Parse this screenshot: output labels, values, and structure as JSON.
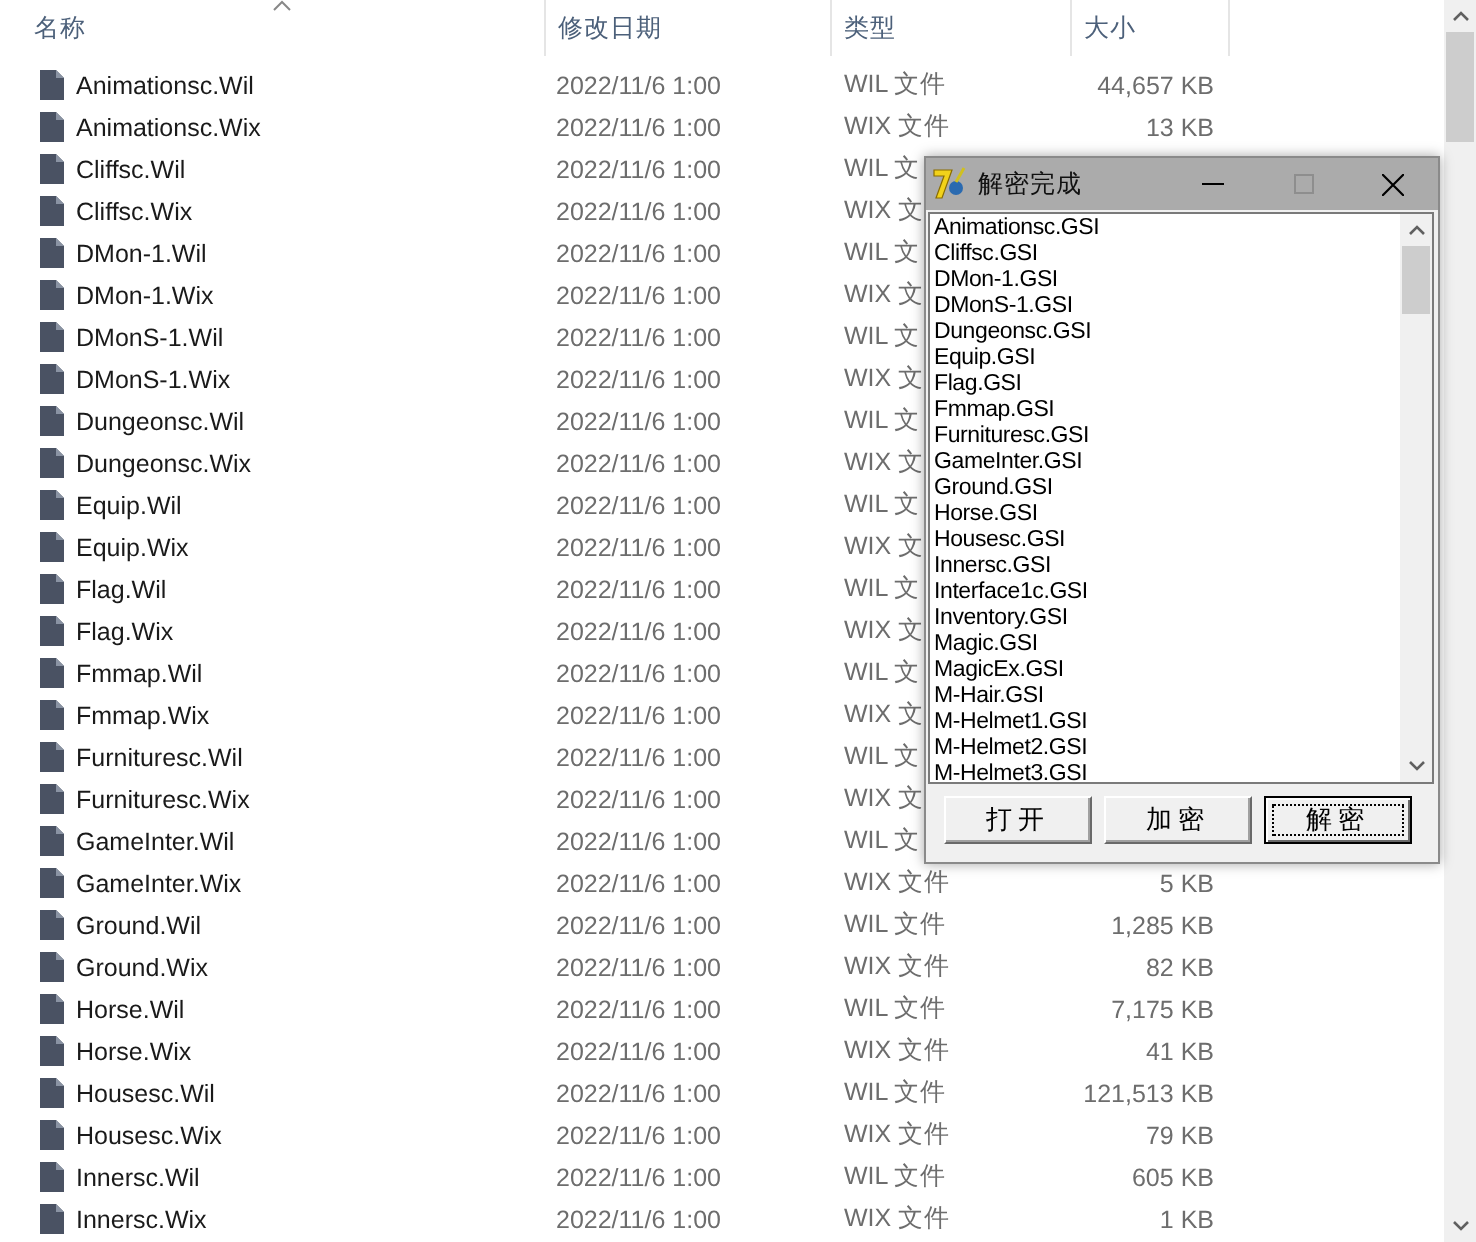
{
  "columns": [
    {
      "label": "名称",
      "sorted": true
    },
    {
      "label": "修改日期",
      "sorted": false
    },
    {
      "label": "类型",
      "sorted": false
    },
    {
      "label": "大小",
      "sorted": false
    }
  ],
  "files": [
    {
      "name": "Animationsc.Wil",
      "date": "2022/11/6 1:00",
      "type": "WIL 文件",
      "size": "44,657 KB"
    },
    {
      "name": "Animationsc.Wix",
      "date": "2022/11/6 1:00",
      "type": "WIX 文件",
      "size": "13 KB"
    },
    {
      "name": "Cliffsc.Wil",
      "date": "2022/11/6 1:00",
      "type": "WIL 文"
    },
    {
      "name": "Cliffsc.Wix",
      "date": "2022/11/6 1:00",
      "type": "WIX 文"
    },
    {
      "name": "DMon-1.Wil",
      "date": "2022/11/6 1:00",
      "type": "WIL 文"
    },
    {
      "name": "DMon-1.Wix",
      "date": "2022/11/6 1:00",
      "type": "WIX 文"
    },
    {
      "name": "DMonS-1.Wil",
      "date": "2022/11/6 1:00",
      "type": "WIL 文"
    },
    {
      "name": "DMonS-1.Wix",
      "date": "2022/11/6 1:00",
      "type": "WIX 文"
    },
    {
      "name": "Dungeonsc.Wil",
      "date": "2022/11/6 1:00",
      "type": "WIL 文"
    },
    {
      "name": "Dungeonsc.Wix",
      "date": "2022/11/6 1:00",
      "type": "WIX 文"
    },
    {
      "name": "Equip.Wil",
      "date": "2022/11/6 1:00",
      "type": "WIL 文"
    },
    {
      "name": "Equip.Wix",
      "date": "2022/11/6 1:00",
      "type": "WIX 文"
    },
    {
      "name": "Flag.Wil",
      "date": "2022/11/6 1:00",
      "type": "WIL 文"
    },
    {
      "name": "Flag.Wix",
      "date": "2022/11/6 1:00",
      "type": "WIX 文"
    },
    {
      "name": "Fmmap.Wil",
      "date": "2022/11/6 1:00",
      "type": "WIL 文"
    },
    {
      "name": "Fmmap.Wix",
      "date": "2022/11/6 1:00",
      "type": "WIX 文"
    },
    {
      "name": "Furnituresc.Wil",
      "date": "2022/11/6 1:00",
      "type": "WIL 文"
    },
    {
      "name": "Furnituresc.Wix",
      "date": "2022/11/6 1:00",
      "type": "WIX 文"
    },
    {
      "name": "GameInter.Wil",
      "date": "2022/11/6 1:00",
      "type": "WIL 文"
    },
    {
      "name": "GameInter.Wix",
      "date": "2022/11/6 1:00",
      "type": "WIX 文件",
      "size": "5 KB"
    },
    {
      "name": "Ground.Wil",
      "date": "2022/11/6 1:00",
      "type": "WIL 文件",
      "size": "1,285 KB"
    },
    {
      "name": "Ground.Wix",
      "date": "2022/11/6 1:00",
      "type": "WIX 文件",
      "size": "82 KB"
    },
    {
      "name": "Horse.Wil",
      "date": "2022/11/6 1:00",
      "type": "WIL 文件",
      "size": "7,175 KB"
    },
    {
      "name": "Horse.Wix",
      "date": "2022/11/6 1:00",
      "type": "WIX 文件",
      "size": "41 KB"
    },
    {
      "name": "Housesc.Wil",
      "date": "2022/11/6 1:00",
      "type": "WIL 文件",
      "size": "121,513 KB"
    },
    {
      "name": "Housesc.Wix",
      "date": "2022/11/6 1:00",
      "type": "WIX 文件",
      "size": "79 KB"
    },
    {
      "name": "Innersc.Wil",
      "date": "2022/11/6 1:00",
      "type": "WIL 文件",
      "size": "605 KB"
    },
    {
      "name": "Innersc.Wix",
      "date": "2022/11/6 1:00",
      "type": "WIX 文件",
      "size": "1 KB"
    }
  ],
  "dialog": {
    "title": "解密完成",
    "items": [
      "Animationsc.GSI",
      "Cliffsc.GSI",
      "DMon-1.GSI",
      "DMonS-1.GSI",
      "Dungeonsc.GSI",
      "Equip.GSI",
      "Flag.GSI",
      "Fmmap.GSI",
      "Furnituresc.GSI",
      "GameInter.GSI",
      "Ground.GSI",
      "Horse.GSI",
      "Housesc.GSI",
      "Innersc.GSI",
      "Interface1c.GSI",
      "Inventory.GSI",
      "Magic.GSI",
      "MagicEx.GSI",
      "M-Hair.GSI",
      "M-Helmet1.GSI",
      "M-Helmet2.GSI",
      "M-Helmet3.GSI"
    ],
    "buttons": [
      {
        "label": "打开",
        "focused": false
      },
      {
        "label": "加密",
        "focused": false
      },
      {
        "label": "解密",
        "focused": true
      }
    ]
  }
}
